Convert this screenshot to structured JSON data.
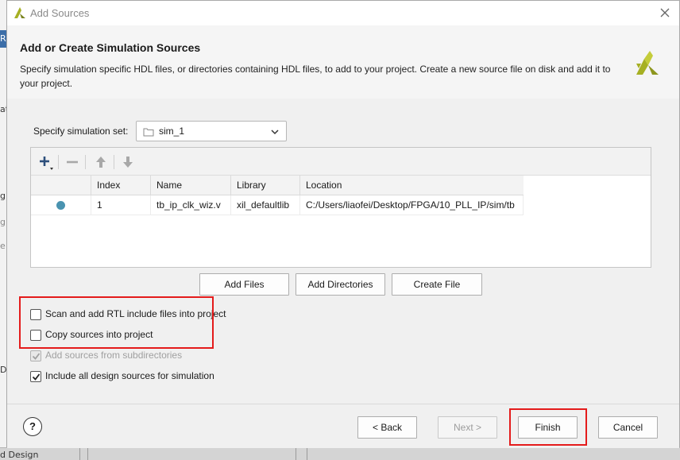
{
  "background": {
    "fragments": [
      "R",
      "at",
      "g",
      "g",
      "e",
      "D",
      "d Design"
    ]
  },
  "dialog": {
    "title": "Add Sources",
    "heading": "Add or Create Simulation Sources",
    "description": "Specify simulation specific HDL files, or directories containing HDL files, to add to your project. Create a new source file on disk and add it to your project.",
    "sim_set": {
      "label": "Specify simulation set:",
      "value": "sim_1"
    },
    "table": {
      "columns": [
        "",
        "Index",
        "Name",
        "Library",
        "Location"
      ],
      "rows": [
        {
          "index": "1",
          "name": "tb_ip_clk_wiz.v",
          "library": "xil_defaultlib",
          "location": "C:/Users/liaofei/Desktop/FPGA/10_PLL_IP/sim/tb"
        }
      ]
    },
    "buttons": {
      "add_files": "Add Files",
      "add_directories": "Add Directories",
      "create_file": "Create File"
    },
    "options": [
      {
        "label": "Scan and add RTL include files into project",
        "checked": false,
        "enabled": true
      },
      {
        "label": "Copy sources into project",
        "checked": false,
        "enabled": true
      },
      {
        "label": "Add sources from subdirectories",
        "checked": true,
        "enabled": false
      },
      {
        "label": "Include all design sources for simulation",
        "checked": true,
        "enabled": true
      }
    ],
    "footer": {
      "help": "?",
      "back": "< Back",
      "next": "Next >",
      "finish": "Finish",
      "cancel": "Cancel"
    }
  },
  "colors": {
    "highlight": "#e41b1b",
    "status_dot": "#4a93b0",
    "logo": "#a6b023"
  }
}
